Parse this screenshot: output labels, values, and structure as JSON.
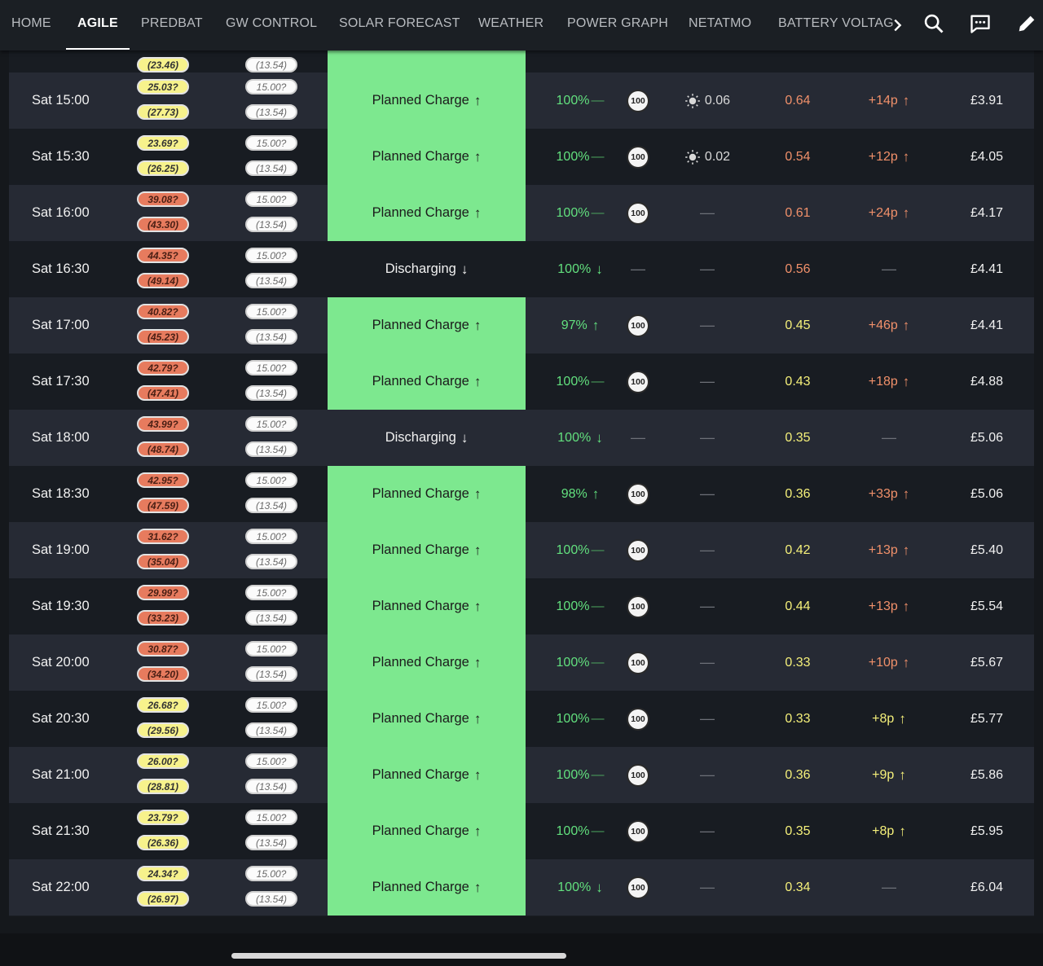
{
  "tabs": [
    "HOME",
    "AGILE",
    "PREDBAT",
    "GW CONTROL",
    "SOLAR FORECAST",
    "WEATHER",
    "POWER GRAPH",
    "NETATMO",
    "BATTERY VOLTAG"
  ],
  "active_tab": "AGILE",
  "icons": [
    "chevron-right-icon",
    "search-icon",
    "chat-icon",
    "pencil-icon"
  ],
  "colors": {
    "charge": "#7de88f",
    "import_yellow": "#f7f28c",
    "import_red": "#e77b5e",
    "soc_green": "#62e07e",
    "cost_orange": "#f0906a",
    "cost_yellow": "#f5f07a"
  },
  "partial_row": {
    "import_low": "(23.46)",
    "export_low": "(13.54)"
  },
  "rows": [
    {
      "time": "Sat 15:00",
      "imp_hi": "25.03?",
      "imp_lo": "(27.73)",
      "imp_color": "yellow",
      "exp_hi": "15.00?",
      "exp_lo": "(13.54)",
      "status": "Planned Charge",
      "status_type": "charge",
      "soc": "100%",
      "soc_trend": "flat",
      "limit": "100",
      "pv": "0.06",
      "load": "0.64",
      "load_color": "orange",
      "cost": "+14p",
      "cost_color": "orange",
      "total": "£3.91"
    },
    {
      "time": "Sat 15:30",
      "imp_hi": "23.69?",
      "imp_lo": "(26.25)",
      "imp_color": "yellow",
      "exp_hi": "15.00?",
      "exp_lo": "(13.54)",
      "status": "Planned Charge",
      "status_type": "charge",
      "soc": "100%",
      "soc_trend": "flat",
      "limit": "100",
      "pv": "0.02",
      "load": "0.54",
      "load_color": "orange",
      "cost": "+12p",
      "cost_color": "orange",
      "total": "£4.05"
    },
    {
      "time": "Sat 16:00",
      "imp_hi": "39.08?",
      "imp_lo": "(43.30)",
      "imp_color": "red",
      "exp_hi": "15.00?",
      "exp_lo": "(13.54)",
      "status": "Planned Charge",
      "status_type": "charge",
      "soc": "100%",
      "soc_trend": "flat",
      "limit": "100",
      "pv": "",
      "load": "0.61",
      "load_color": "orange",
      "cost": "+24p",
      "cost_color": "orange",
      "total": "£4.17"
    },
    {
      "time": "Sat 16:30",
      "imp_hi": "44.35?",
      "imp_lo": "(49.14)",
      "imp_color": "red",
      "exp_hi": "15.00?",
      "exp_lo": "(13.54)",
      "status": "Discharging",
      "status_type": "discharge",
      "soc": "100%",
      "soc_trend": "down",
      "limit": "",
      "pv": "",
      "load": "0.56",
      "load_color": "orange",
      "cost": "",
      "cost_color": "orange",
      "total": "£4.41"
    },
    {
      "time": "Sat 17:00",
      "imp_hi": "40.82?",
      "imp_lo": "(45.23)",
      "imp_color": "red",
      "exp_hi": "15.00?",
      "exp_lo": "(13.54)",
      "status": "Planned Charge",
      "status_type": "charge",
      "soc": "97%",
      "soc_trend": "up",
      "limit": "100",
      "pv": "",
      "load": "0.45",
      "load_color": "yellow",
      "cost": "+46p",
      "cost_color": "orange",
      "total": "£4.41"
    },
    {
      "time": "Sat 17:30",
      "imp_hi": "42.79?",
      "imp_lo": "(47.41)",
      "imp_color": "red",
      "exp_hi": "15.00?",
      "exp_lo": "(13.54)",
      "status": "Planned Charge",
      "status_type": "charge",
      "soc": "100%",
      "soc_trend": "flat",
      "limit": "100",
      "pv": "",
      "load": "0.43",
      "load_color": "yellow",
      "cost": "+18p",
      "cost_color": "orange",
      "total": "£4.88"
    },
    {
      "time": "Sat 18:00",
      "imp_hi": "43.99?",
      "imp_lo": "(48.74)",
      "imp_color": "red",
      "exp_hi": "15.00?",
      "exp_lo": "(13.54)",
      "status": "Discharging",
      "status_type": "discharge",
      "soc": "100%",
      "soc_trend": "down",
      "limit": "",
      "pv": "",
      "load": "0.35",
      "load_color": "yellow",
      "cost": "",
      "cost_color": "orange",
      "total": "£5.06"
    },
    {
      "time": "Sat 18:30",
      "imp_hi": "42.95?",
      "imp_lo": "(47.59)",
      "imp_color": "red",
      "exp_hi": "15.00?",
      "exp_lo": "(13.54)",
      "status": "Planned Charge",
      "status_type": "charge",
      "soc": "98%",
      "soc_trend": "up",
      "limit": "100",
      "pv": "",
      "load": "0.36",
      "load_color": "yellow",
      "cost": "+33p",
      "cost_color": "orange",
      "total": "£5.06"
    },
    {
      "time": "Sat 19:00",
      "imp_hi": "31.62?",
      "imp_lo": "(35.04)",
      "imp_color": "red",
      "exp_hi": "15.00?",
      "exp_lo": "(13.54)",
      "status": "Planned Charge",
      "status_type": "charge",
      "soc": "100%",
      "soc_trend": "flat",
      "limit": "100",
      "pv": "",
      "load": "0.42",
      "load_color": "yellow",
      "cost": "+13p",
      "cost_color": "orange",
      "total": "£5.40"
    },
    {
      "time": "Sat 19:30",
      "imp_hi": "29.99?",
      "imp_lo": "(33.23)",
      "imp_color": "red",
      "exp_hi": "15.00?",
      "exp_lo": "(13.54)",
      "status": "Planned Charge",
      "status_type": "charge",
      "soc": "100%",
      "soc_trend": "flat",
      "limit": "100",
      "pv": "",
      "load": "0.44",
      "load_color": "yellow",
      "cost": "+13p",
      "cost_color": "orange",
      "total": "£5.54"
    },
    {
      "time": "Sat 20:00",
      "imp_hi": "30.87?",
      "imp_lo": "(34.20)",
      "imp_color": "red",
      "exp_hi": "15.00?",
      "exp_lo": "(13.54)",
      "status": "Planned Charge",
      "status_type": "charge",
      "soc": "100%",
      "soc_trend": "flat",
      "limit": "100",
      "pv": "",
      "load": "0.33",
      "load_color": "yellow",
      "cost": "+10p",
      "cost_color": "orange",
      "total": "£5.67"
    },
    {
      "time": "Sat 20:30",
      "imp_hi": "26.68?",
      "imp_lo": "(29.56)",
      "imp_color": "yellow",
      "exp_hi": "15.00?",
      "exp_lo": "(13.54)",
      "status": "Planned Charge",
      "status_type": "charge",
      "soc": "100%",
      "soc_trend": "flat",
      "limit": "100",
      "pv": "",
      "load": "0.33",
      "load_color": "yellow",
      "cost": "+8p",
      "cost_color": "yellow",
      "total": "£5.77"
    },
    {
      "time": "Sat 21:00",
      "imp_hi": "26.00?",
      "imp_lo": "(28.81)",
      "imp_color": "yellow",
      "exp_hi": "15.00?",
      "exp_lo": "(13.54)",
      "status": "Planned Charge",
      "status_type": "charge",
      "soc": "100%",
      "soc_trend": "flat",
      "limit": "100",
      "pv": "",
      "load": "0.36",
      "load_color": "yellow",
      "cost": "+9p",
      "cost_color": "yellow",
      "total": "£5.86"
    },
    {
      "time": "Sat 21:30",
      "imp_hi": "23.79?",
      "imp_lo": "(26.36)",
      "imp_color": "yellow",
      "exp_hi": "15.00?",
      "exp_lo": "(13.54)",
      "status": "Planned Charge",
      "status_type": "charge",
      "soc": "100%",
      "soc_trend": "flat",
      "limit": "100",
      "pv": "",
      "load": "0.35",
      "load_color": "yellow",
      "cost": "+8p",
      "cost_color": "yellow",
      "total": "£5.95"
    },
    {
      "time": "Sat 22:00",
      "imp_hi": "24.34?",
      "imp_lo": "(26.97)",
      "imp_color": "yellow",
      "exp_hi": "15.00?",
      "exp_lo": "(13.54)",
      "status": "Planned Charge",
      "status_type": "charge",
      "soc": "100%",
      "soc_trend": "down",
      "limit": "100",
      "pv": "",
      "load": "0.34",
      "load_color": "yellow",
      "cost": "",
      "cost_color": "orange",
      "total": "£6.04"
    }
  ]
}
